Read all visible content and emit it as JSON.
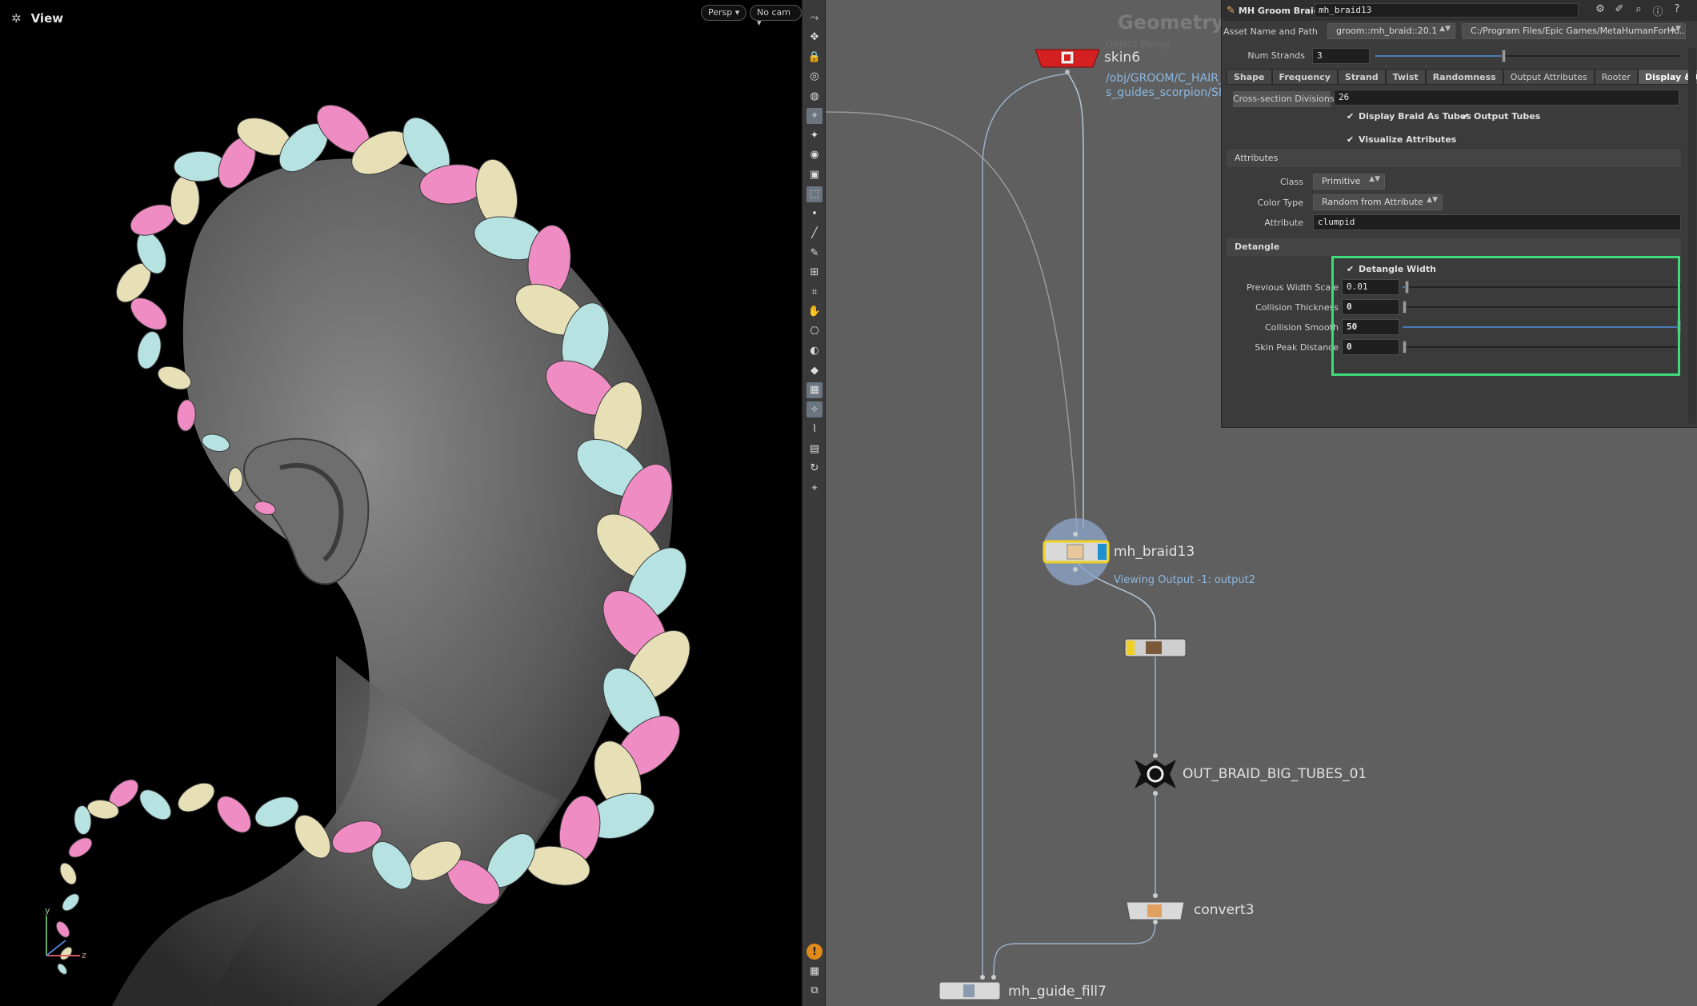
{
  "viewport": {
    "title": "View",
    "persp_label": "Persp",
    "camera_label": "No cam",
    "axis_y": "y",
    "axis_z": "z"
  },
  "shelf": {
    "icons": [
      "view-tool-icon",
      "pose-tool-icon",
      "lock-icon",
      "select-icon",
      "handle-icon",
      "snap-icon",
      "light-icon",
      "camera-icon",
      "display-icon",
      "group-icon",
      "point-icon",
      "edge-icon",
      "brush-icon",
      "grid-icon",
      "attribute-icon",
      "sculpt-icon",
      "template-icon",
      "view-options-icon",
      "ghost-icon",
      "background-icon",
      "light-toggle-icon",
      "wire-icon",
      "hide-icon",
      "cook-icon",
      "pin-icon",
      "warning-icon",
      "layout-icon",
      "snapshot-icon"
    ]
  },
  "network": {
    "context_title": "Geometry",
    "context_sub": "Object Merge",
    "nodes": {
      "skin": {
        "name": "skin6",
        "path_line1": "/obj/GROOM/C_HAIR_B",
        "path_line2": "s_guides_scorpion/SKIN"
      },
      "braid": {
        "name": "mh_braid13",
        "note": "Viewing Output -1: output2"
      },
      "null_out": {
        "name": "OUT_BRAID_BIG_TUBES_01"
      },
      "convert": {
        "name": "convert3"
      },
      "guide_fill": {
        "name": "mh_guide_fill7"
      }
    }
  },
  "params": {
    "node_type": "MH Groom Braid",
    "node_name": "mh_braid13",
    "asset_label": "Asset Name and Path",
    "asset_name": "groom::mh_braid::20.1",
    "asset_path": "C:/Program Files/Epic Games/MetaHumanForHo...",
    "num_strands_label": "Num Strands",
    "num_strands": "3",
    "num_strands_fraction": 0.42,
    "tabs": [
      "Shape",
      "Frequency",
      "Strand",
      "Twist",
      "Randomness",
      "Output Attributes",
      "Rooter",
      "Display & Output"
    ],
    "active_tab": "Display & Output",
    "cross_section_label": "Cross-section Divisions",
    "cross_section": "26",
    "display_as_tubes": "Display Braid As Tubes",
    "output_tubes": "Output Tubes",
    "visualize_attributes": "Visualize Attributes",
    "attributes_section": "Attributes",
    "class_label": "Class",
    "class_value": "Primitive",
    "color_type_label": "Color Type",
    "color_type_value": "Random from Attribute",
    "attribute_label": "Attribute",
    "attribute_value": "clumpid",
    "detangle_section": "Detangle",
    "detangle_width": "Detangle Width",
    "prev_width_label": "Previous Width Scale",
    "prev_width_value": "0.01",
    "prev_width_fraction": 0.01,
    "collision_thick_label": "Collision Thickness",
    "collision_thick_value": "0",
    "collision_thick_fraction": 0,
    "collision_smooth_label": "Collision Smooth",
    "collision_smooth_value": "50",
    "collision_smooth_fraction": 1,
    "skin_peak_label": "Skin Peak Distance",
    "skin_peak_value": "0",
    "skin_peak_fraction": 0
  },
  "colors": {
    "braid_pink": "#f08cc4",
    "braid_blue": "#b6e2e2",
    "braid_cream": "#e7e0b6",
    "highlight": "#3ddb7a",
    "skin_node": "#d42020",
    "note_blue": "#8cb8e0"
  }
}
